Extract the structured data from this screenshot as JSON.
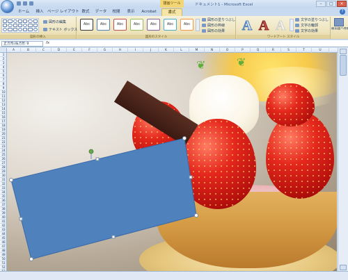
{
  "window": {
    "context_tab_group": "描画ツール",
    "title": "ドキュメント1 - Microsoft Excel"
  },
  "tabs": [
    "ホーム",
    "挿入",
    "ページ レイアウト",
    "数式",
    "データ",
    "校閲",
    "表示",
    "Acrobat",
    "書式"
  ],
  "active_tab": "書式",
  "ribbon": {
    "insert_shapes": {
      "label": "図形の挿入",
      "edit_shape": "図形の編集",
      "text_box": "テキスト ボックス"
    },
    "shape_styles": {
      "label": "図形のスタイル",
      "sample_text": "Abc",
      "fill": "図形の塗りつぶし",
      "outline": "図形の枠線",
      "effects": "図形の効果"
    },
    "wordart_styles": {
      "label": "ワードアート スタイル",
      "sample": "A",
      "text_fill": "文字の塗りつぶし",
      "text_outline": "文字の輪郭",
      "text_effects": "文字の効果"
    },
    "arrange": {
      "bring_front": "最前面へ移動"
    }
  },
  "formula_bar": {
    "name_box": "正方形/長方形 9",
    "fx": "fx"
  },
  "columns": [
    "A",
    "B",
    "C",
    "D",
    "E",
    "F",
    "G",
    "H",
    "I",
    "J",
    "K",
    "L",
    "M",
    "N",
    "O",
    "P",
    "Q",
    "R",
    "S",
    "T",
    "U"
  ],
  "rows": [
    "1",
    "2",
    "3",
    "4",
    "5",
    "6",
    "7",
    "8",
    "9",
    "10",
    "11",
    "12",
    "13",
    "14",
    "15",
    "16",
    "17",
    "18",
    "19",
    "20",
    "21",
    "22",
    "23",
    "24",
    "25",
    "26",
    "27",
    "28",
    "29",
    "30",
    "31",
    "32",
    "33",
    "34",
    "35",
    "36",
    "37",
    "38",
    "39",
    "40",
    "41",
    "42",
    "43",
    "44",
    "45",
    "46",
    "47",
    "48",
    "49",
    "50",
    "51",
    "52",
    "53"
  ],
  "colors": {
    "shape_fill": "#4f81bd",
    "selection_handle": "#6aa84f",
    "active_tab": "#f5e6a8"
  }
}
